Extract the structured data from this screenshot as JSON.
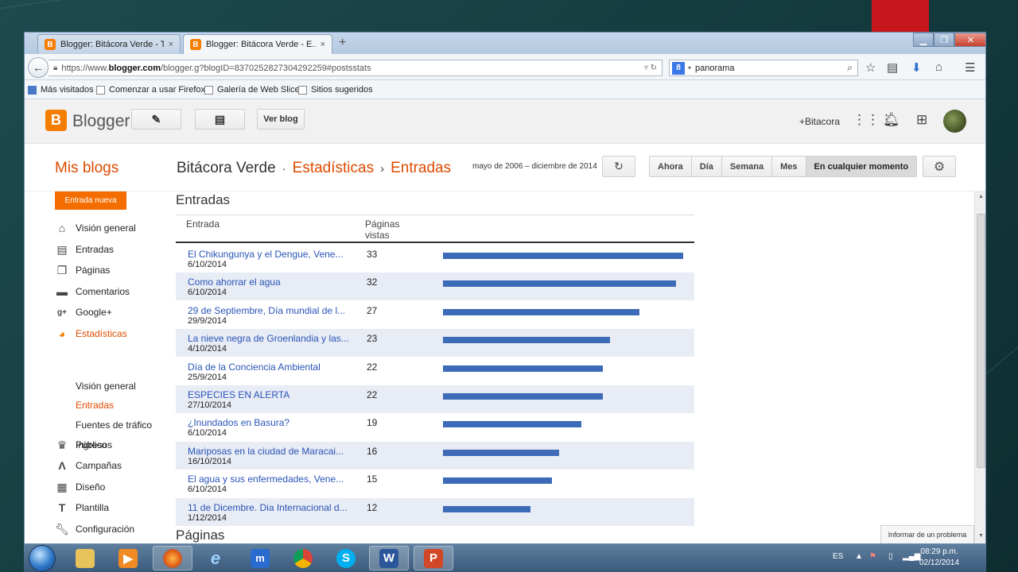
{
  "browser": {
    "tabs": [
      {
        "title": "Blogger: Bitácora Verde - T...",
        "close": "×"
      },
      {
        "title": "Blogger: Bitácora Verde - E...",
        "close": "×"
      }
    ],
    "new_tab": "+",
    "url_prefix": "https://www.",
    "url_domain": "blogger.com",
    "url_path": "/blogger.g?blogID=8370252827304292259#postsstats",
    "search_engine": "8",
    "search_value": "panorama",
    "bookmarks": [
      "Más visitados",
      "Comenzar a usar Firefox",
      "Galería de Web Slice",
      "Sitios sugeridos"
    ]
  },
  "header": {
    "logo_letter": "B",
    "brand": "Blogger",
    "view_blog": "Ver blog",
    "plus_name": "+Bitacora"
  },
  "titlebar": {
    "my_blogs": "Mis blogs",
    "blog_name": "Bitácora Verde",
    "dot": "·",
    "section": "Estadísticas",
    "chevron": "›",
    "subsection": "Entradas",
    "date_range": "mayo de 2006 – diciembre de 2014",
    "ranges": [
      "Ahora",
      "Día",
      "Semana",
      "Mes",
      "En cualquier momento"
    ],
    "selected_range": "En cualquier momento"
  },
  "sidebar": {
    "new_post": "Entrada nueva",
    "items": [
      {
        "label": "Visión general",
        "icon": "home-icon"
      },
      {
        "label": "Entradas",
        "icon": "posts-icon"
      },
      {
        "label": "Páginas",
        "icon": "pages-icon"
      },
      {
        "label": "Comentarios",
        "icon": "comments-icon"
      },
      {
        "label": "Google+",
        "icon": "google-plus-icon"
      },
      {
        "label": "Estadísticas",
        "icon": "stats-icon"
      }
    ],
    "stats_sub": [
      "Visión general",
      "Entradas",
      "Fuentes de tráfico",
      "Público"
    ],
    "items2": [
      {
        "label": "Ingresos",
        "icon": "trophy-icon"
      },
      {
        "label": "Campañas",
        "icon": "campaigns-icon"
      },
      {
        "label": "Diseño",
        "icon": "layout-icon"
      },
      {
        "label": "Plantilla",
        "icon": "template-icon"
      },
      {
        "label": "Configuración",
        "icon": "wrench-icon"
      }
    ]
  },
  "main": {
    "section_title": "Entradas",
    "col_post": "Entrada",
    "col_views_line1": "Páginas",
    "col_views_line2": "vistas",
    "rows": [
      {
        "title": "El Chikungunya y el Dengue, Vene...",
        "date": "6/10/2014",
        "views": 33
      },
      {
        "title": "Como ahorrar el agua",
        "date": "6/10/2014",
        "views": 32
      },
      {
        "title": "29 de Septiembre, Día mundial de l...",
        "date": "29/9/2014",
        "views": 27
      },
      {
        "title": "La nieve negra de Groenlandia y las...",
        "date": "4/10/2014",
        "views": 23
      },
      {
        "title": "Día de la Conciencia Ambiental",
        "date": "25/9/2014",
        "views": 22
      },
      {
        "title": "ESPECIES EN ALERTA",
        "date": "27/10/2014",
        "views": 22
      },
      {
        "title": "¿Inundados en Basura?",
        "date": "6/10/2014",
        "views": 19
      },
      {
        "title": "Mariposas en la ciudad de Maracai...",
        "date": "16/10/2014",
        "views": 16
      },
      {
        "title": "El agua y sus enfermedades, Vene...",
        "date": "6/10/2014",
        "views": 15
      },
      {
        "title": "11 de Dicembre. Dia Internacional d...",
        "date": "1/12/2014",
        "views": 12
      }
    ],
    "next_section": "Páginas",
    "report_problem": "Informar de un problema"
  },
  "taskbar": {
    "lang": "ES",
    "time": "08:29 p.m.",
    "date": "02/12/2014"
  },
  "colors": {
    "brand_orange": "#f57d00",
    "link_blue": "#2a54b8",
    "bar_blue": "#3d6bb8",
    "row_alt": "#e8ecf5"
  }
}
